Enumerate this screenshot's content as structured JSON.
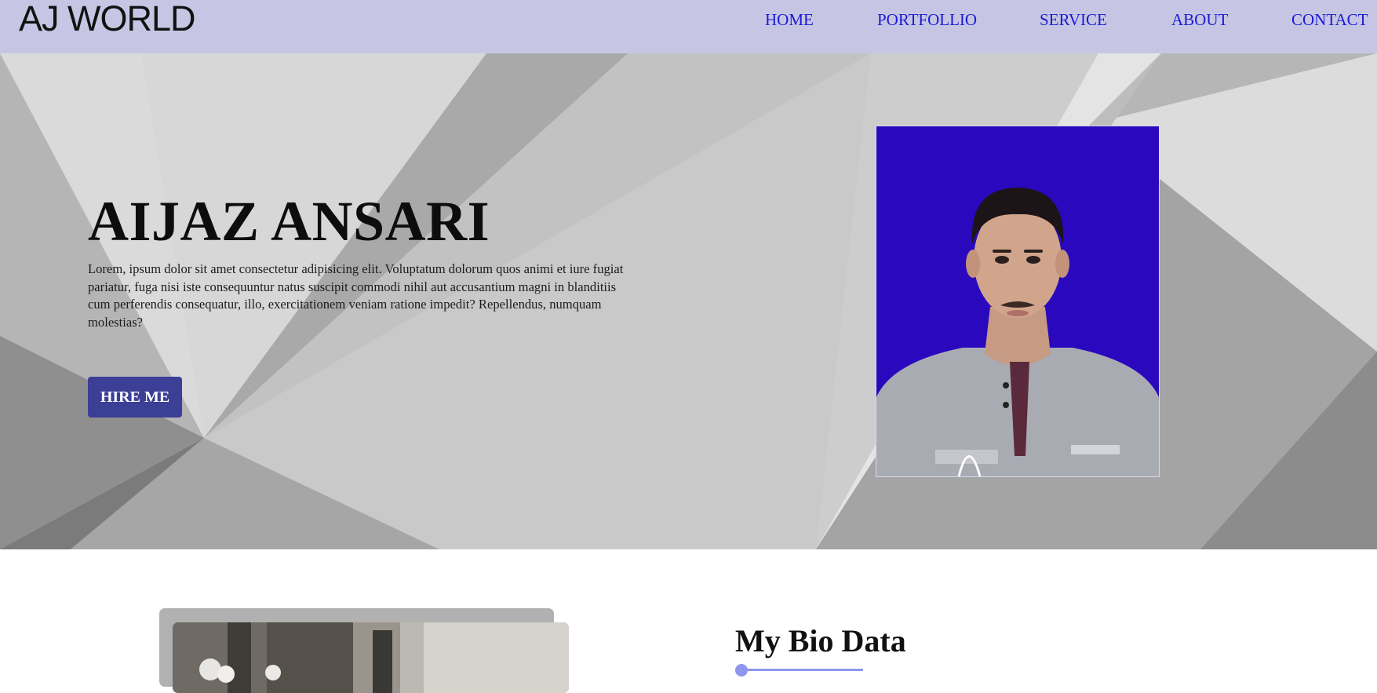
{
  "header": {
    "logo": "AJ WORLD",
    "nav": [
      {
        "label": "HOME"
      },
      {
        "label": "PORTFOLLIO"
      },
      {
        "label": "SERVICE"
      },
      {
        "label": "ABOUT"
      },
      {
        "label": "CONTACT"
      }
    ]
  },
  "hero": {
    "name": "AIJAZ ANSARI",
    "text": "Lorem, ipsum dolor sit amet consectetur adipisicing elit. Voluptatum dolorum quos animi et iure fugiat pariatur, fuga nisi iste consequuntur natus suscipit commodi nihil aut accusantium magni in blanditiis cum perferendis consequatur, illo, exercitationem veniam ratione impedit? Repellendus, numquam molestias?",
    "button": "HIRE ME"
  },
  "bio": {
    "title": "My Bio Data"
  },
  "colors": {
    "header_bg": "#c6c6e4",
    "nav_link": "#1a1ad6",
    "button_bg": "#3b3f96",
    "portrait_bg": "#2a08bd",
    "accent": "#8e96f0"
  }
}
